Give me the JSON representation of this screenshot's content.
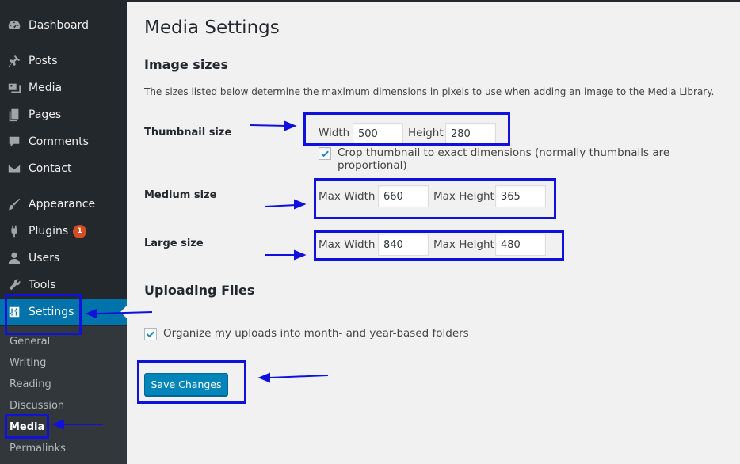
{
  "sidebar": {
    "items": [
      {
        "label": "Dashboard",
        "icon": "dashboard-icon"
      },
      {
        "label": "Posts",
        "icon": "pin-icon"
      },
      {
        "label": "Media",
        "icon": "media-icon"
      },
      {
        "label": "Pages",
        "icon": "pages-icon"
      },
      {
        "label": "Comments",
        "icon": "comment-icon"
      },
      {
        "label": "Contact",
        "icon": "mail-icon"
      },
      {
        "label": "Appearance",
        "icon": "brush-icon"
      },
      {
        "label": "Plugins",
        "icon": "plugin-icon",
        "badge": "1"
      },
      {
        "label": "Users",
        "icon": "user-icon"
      },
      {
        "label": "Tools",
        "icon": "wrench-icon"
      },
      {
        "label": "Settings",
        "icon": "settings-icon"
      }
    ],
    "submenu": [
      "General",
      "Writing",
      "Reading",
      "Discussion",
      "Media",
      "Permalinks"
    ]
  },
  "main": {
    "title": "Media Settings",
    "image_sizes": {
      "heading": "Image sizes",
      "description": "The sizes listed below determine the maximum dimensions in pixels to use when adding an image to the Media Library.",
      "thumbnail": {
        "label": "Thumbnail size",
        "width_label": "Width",
        "width": "500",
        "height_label": "Height",
        "height": "280",
        "crop_label": "Crop thumbnail to exact dimensions (normally thumbnails are proportional)",
        "crop_checked": true
      },
      "medium": {
        "label": "Medium size",
        "max_width_label": "Max Width",
        "max_width": "660",
        "max_height_label": "Max Height",
        "max_height": "365"
      },
      "large": {
        "label": "Large size",
        "max_width_label": "Max Width",
        "max_width": "840",
        "max_height_label": "Max Height",
        "max_height": "480"
      }
    },
    "uploading": {
      "heading": "Uploading Files",
      "organize_label": "Organize my uploads into month- and year-based folders",
      "organize_checked": true
    },
    "save_label": "Save Changes"
  },
  "colors": {
    "sidebar_bg": "#23282d",
    "submenu_bg": "#32373c",
    "accent": "#0073aa",
    "button": "#0085ba",
    "annotation": "#1111dd"
  }
}
